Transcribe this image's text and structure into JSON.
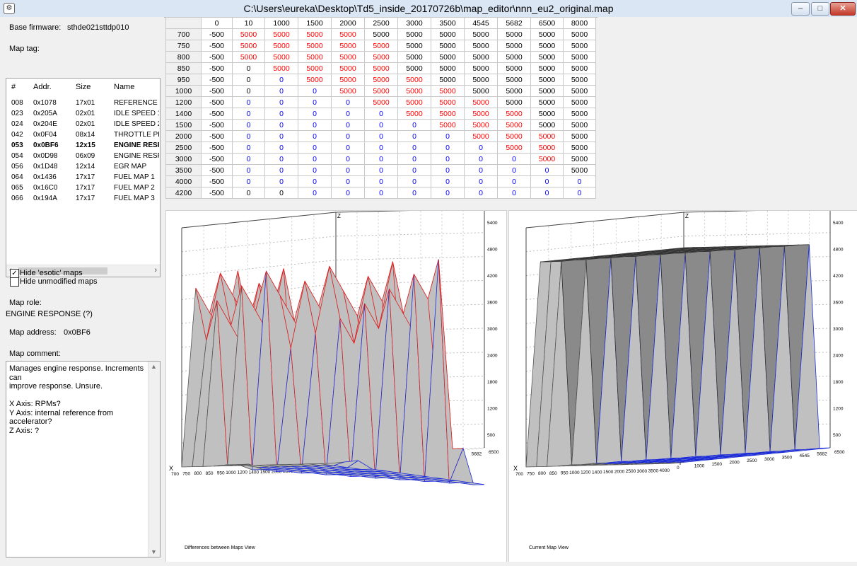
{
  "window": {
    "title": "C:\\Users\\eureka\\Desktop\\Td5_inside_20170726b\\map_editor\\nnn_eu2_original.map",
    "buttons": {
      "minimize": "–",
      "maximize": "□",
      "close": "✕"
    }
  },
  "left": {
    "base_firmware_label": "Base firmware:",
    "base_firmware_value": "sthde021sttdp010",
    "map_tag_label": "Map tag:",
    "list_headers": [
      "#",
      "Addr.",
      "Size",
      "Name"
    ],
    "list_rows": [
      {
        "num": "008",
        "addr": "0x1078",
        "size": "17x01",
        "name": "REFERENCE CURVE"
      },
      {
        "num": "023",
        "addr": "0x205A",
        "size": "02x01",
        "name": "IDLE SPEED 1"
      },
      {
        "num": "024",
        "addr": "0x204E",
        "size": "02x01",
        "name": "IDLE SPEED 2"
      },
      {
        "num": "042",
        "addr": "0x0F04",
        "size": "08x14",
        "name": "THROTTLE PEDAL"
      },
      {
        "num": "053",
        "addr": "0x0BF6",
        "size": "12x15",
        "name": "ENGINE RESPONSE"
      },
      {
        "num": "054",
        "addr": "0x0D98",
        "size": "06x09",
        "name": "ENGINE RESPONSE"
      },
      {
        "num": "056",
        "addr": "0x1D48",
        "size": "12x14",
        "name": "EGR MAP"
      },
      {
        "num": "064",
        "addr": "0x1436",
        "size": "17x17",
        "name": "FUEL MAP 1"
      },
      {
        "num": "065",
        "addr": "0x16C0",
        "size": "17x17",
        "name": "FUEL MAP 2"
      },
      {
        "num": "066",
        "addr": "0x194A",
        "size": "17x17",
        "name": "FUEL MAP 3"
      }
    ],
    "selected_row": 4,
    "hide_esotic_label": "Hide 'esotic' maps",
    "hide_esotic_checked": true,
    "hide_unmodified_label": "Hide unmodified maps",
    "hide_unmodified_checked": false,
    "map_role_label": "Map role:",
    "map_role_value": "ENGINE RESPONSE (?)",
    "map_address_label": "Map address:",
    "map_address_value": "0x0BF6",
    "map_comment_label": "Map comment:",
    "map_comment_lines": [
      "Manages engine response. Increments can",
      "improve response. Unsure.",
      "",
      "X Axis: RPMs?",
      "Y Axis: internal reference from accelerator?",
      "Z Axis: ?"
    ]
  },
  "grid": {
    "col_headers": [
      "0",
      "10",
      "1000",
      "1500",
      "2000",
      "2500",
      "3000",
      "3500",
      "4545",
      "5682",
      "6500",
      "8000"
    ],
    "row_headers": [
      "700",
      "750",
      "800",
      "850",
      "950",
      "1000",
      "1200",
      "1400",
      "1500",
      "2000",
      "2500",
      "3000",
      "3500",
      "4000",
      "4200"
    ],
    "cells": [
      [
        "-500",
        "5000",
        "5000",
        "5000",
        "5000",
        "5000",
        "5000",
        "5000",
        "5000",
        "5000",
        "5000",
        "5000"
      ],
      [
        "-500",
        "5000",
        "5000",
        "5000",
        "5000",
        "5000",
        "5000",
        "5000",
        "5000",
        "5000",
        "5000",
        "5000"
      ],
      [
        "-500",
        "5000",
        "5000",
        "5000",
        "5000",
        "5000",
        "5000",
        "5000",
        "5000",
        "5000",
        "5000",
        "5000"
      ],
      [
        "-500",
        "0",
        "5000",
        "5000",
        "5000",
        "5000",
        "5000",
        "5000",
        "5000",
        "5000",
        "5000",
        "5000"
      ],
      [
        "-500",
        "0",
        "0",
        "5000",
        "5000",
        "5000",
        "5000",
        "5000",
        "5000",
        "5000",
        "5000",
        "5000"
      ],
      [
        "-500",
        "0",
        "0",
        "0",
        "5000",
        "5000",
        "5000",
        "5000",
        "5000",
        "5000",
        "5000",
        "5000"
      ],
      [
        "-500",
        "0",
        "0",
        "0",
        "0",
        "5000",
        "5000",
        "5000",
        "5000",
        "5000",
        "5000",
        "5000"
      ],
      [
        "-500",
        "0",
        "0",
        "0",
        "0",
        "0",
        "5000",
        "5000",
        "5000",
        "5000",
        "5000",
        "5000"
      ],
      [
        "-500",
        "0",
        "0",
        "0",
        "0",
        "0",
        "0",
        "5000",
        "5000",
        "5000",
        "5000",
        "5000"
      ],
      [
        "-500",
        "0",
        "0",
        "0",
        "0",
        "0",
        "0",
        "0",
        "5000",
        "5000",
        "5000",
        "5000"
      ],
      [
        "-500",
        "0",
        "0",
        "0",
        "0",
        "0",
        "0",
        "0",
        "0",
        "5000",
        "5000",
        "5000"
      ],
      [
        "-500",
        "0",
        "0",
        "0",
        "0",
        "0",
        "0",
        "0",
        "0",
        "0",
        "5000",
        "5000"
      ],
      [
        "-500",
        "0",
        "0",
        "0",
        "0",
        "0",
        "0",
        "0",
        "0",
        "0",
        "0",
        "5000"
      ],
      [
        "-500",
        "0",
        "0",
        "0",
        "0",
        "0",
        "0",
        "0",
        "0",
        "0",
        "0",
        "0"
      ],
      [
        "-500",
        "0",
        "0",
        "0",
        "0",
        "0",
        "0",
        "0",
        "0",
        "0",
        "0",
        "0"
      ]
    ],
    "cell_colors": [
      [
        "k",
        "r",
        "r",
        "r",
        "r",
        "k",
        "k",
        "k",
        "k",
        "k",
        "k",
        "k"
      ],
      [
        "k",
        "r",
        "r",
        "r",
        "r",
        "r",
        "k",
        "k",
        "k",
        "k",
        "k",
        "k"
      ],
      [
        "k",
        "r",
        "r",
        "r",
        "r",
        "r",
        "k",
        "k",
        "k",
        "k",
        "k",
        "k"
      ],
      [
        "k",
        "k",
        "r",
        "r",
        "r",
        "r",
        "k",
        "k",
        "k",
        "k",
        "k",
        "k"
      ],
      [
        "k",
        "k",
        "b",
        "r",
        "r",
        "r",
        "r",
        "k",
        "k",
        "k",
        "k",
        "k"
      ],
      [
        "k",
        "k",
        "b",
        "b",
        "r",
        "r",
        "r",
        "r",
        "k",
        "k",
        "k",
        "k"
      ],
      [
        "k",
        "b",
        "b",
        "b",
        "b",
        "r",
        "r",
        "r",
        "r",
        "k",
        "k",
        "k"
      ],
      [
        "k",
        "b",
        "b",
        "b",
        "b",
        "b",
        "r",
        "r",
        "r",
        "r",
        "k",
        "k"
      ],
      [
        "k",
        "b",
        "b",
        "b",
        "b",
        "b",
        "b",
        "r",
        "r",
        "r",
        "k",
        "k"
      ],
      [
        "k",
        "b",
        "b",
        "b",
        "b",
        "b",
        "b",
        "b",
        "r",
        "r",
        "r",
        "k"
      ],
      [
        "k",
        "b",
        "b",
        "b",
        "b",
        "b",
        "b",
        "b",
        "b",
        "r",
        "r",
        "k"
      ],
      [
        "k",
        "b",
        "b",
        "b",
        "b",
        "b",
        "b",
        "b",
        "b",
        "b",
        "r",
        "k"
      ],
      [
        "k",
        "b",
        "b",
        "b",
        "b",
        "b",
        "b",
        "b",
        "b",
        "b",
        "b",
        "k"
      ],
      [
        "k",
        "b",
        "b",
        "b",
        "b",
        "b",
        "b",
        "b",
        "b",
        "b",
        "b",
        "b"
      ],
      [
        "k",
        "k",
        "k",
        "b",
        "b",
        "b",
        "b",
        "b",
        "b",
        "b",
        "b",
        "b"
      ]
    ]
  },
  "views": {
    "left_caption": "Differences between Maps View",
    "right_caption": "Current Map View",
    "axis_x": "X",
    "axis_y": "Y",
    "axis_z": "Z",
    "z_ticks": [
      "500",
      "1200",
      "1800",
      "2400",
      "3000",
      "3600",
      "4200",
      "4800",
      "5400"
    ],
    "x_ticks": [
      "700",
      "750",
      "800",
      "850",
      "950",
      "1000",
      "1200",
      "1400",
      "1500",
      "2000",
      "2500",
      "3000",
      "3500",
      "4000"
    ],
    "y_ticks": [
      "0",
      "1000",
      "1500",
      "2000",
      "2500",
      "3000",
      "3500",
      "4545",
      "5682",
      "6500"
    ],
    "colors": {
      "red": "#e02020",
      "blue": "#1a2bd9",
      "surface": "#c0c0c0",
      "top": "#8a8a8a"
    }
  }
}
